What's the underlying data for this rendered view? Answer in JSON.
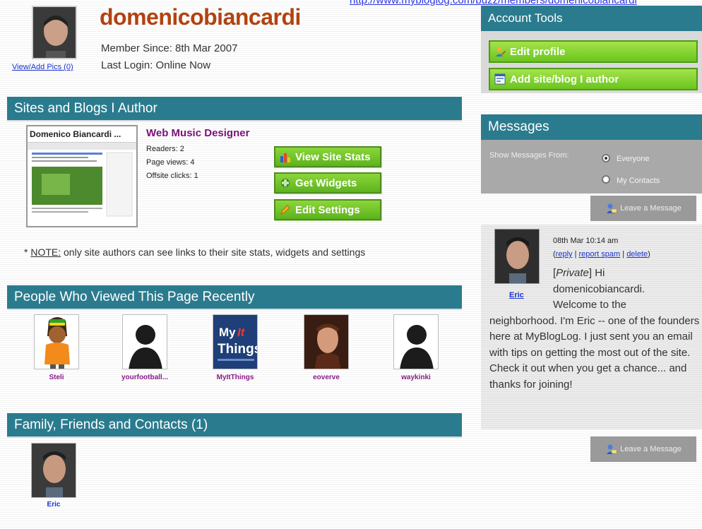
{
  "top_url": "http://www.mybloglog.com/buzz/members/domenicobiancardi",
  "profile": {
    "username": "domenicobiancardi",
    "member_since": "Member Since: 8th Mar 2007",
    "last_login": "Last Login: Online Now",
    "view_pics": "View/Add Pics (0)"
  },
  "sections": {
    "sites": "Sites and Blogs I Author",
    "viewers": "People Who Viewed This Page Recently",
    "friends": "Family, Friends and Contacts (1)"
  },
  "site": {
    "thumb_title": "Domenico Biancardi ...",
    "name": "Web Music Designer",
    "readers": "Readers: 2",
    "page_views": "Page views: 4",
    "offsite_clicks": "Offsite clicks: 1",
    "buttons": {
      "stats": "View Site Stats",
      "widgets": "Get Widgets",
      "settings": "Edit Settings"
    }
  },
  "note": {
    "prefix": "* ",
    "label": "NOTE:",
    "text": " only site authors can see links to their site stats, widgets and settings"
  },
  "viewers": [
    {
      "name": "Steli"
    },
    {
      "name": "yourfootball..."
    },
    {
      "name": "MyItThings"
    },
    {
      "name": "eoverve"
    },
    {
      "name": "waykinki"
    }
  ],
  "friends": [
    {
      "name": "Eric"
    }
  ],
  "account_tools": {
    "title": "Account Tools",
    "edit_profile": "Edit profile",
    "add_site": "Add site/blog I author"
  },
  "messages": {
    "title": "Messages",
    "show_from": "Show Messages From:",
    "opt_everyone": "Everyone",
    "opt_contacts": "My Contacts",
    "selected": "Everyone",
    "leave": "Leave a Message",
    "item": {
      "author": "Eric",
      "date": "08th Mar 10:14 am",
      "reply": "reply",
      "report": "report spam",
      "delete": "delete",
      "private_tag": "Private",
      "greeting": "Hi",
      "line1": "domenicobiancardi.",
      "line2": "Welcome to the",
      "body": "neighborhood. I'm Eric -- one of the founders here at MyBlogLog. I just sent you an email with tips on getting the most out of the site. Check it out when you get a chance... and thanks for joining!"
    }
  },
  "colors": {
    "section_bar": "#2b7b8e",
    "username": "#b3420f",
    "button_green": "#6bc51f"
  }
}
